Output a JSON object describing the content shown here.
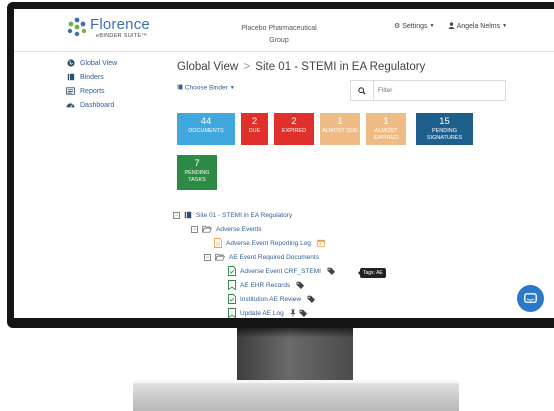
{
  "header": {
    "logo_word": "Florence",
    "logo_sub": "eBINDER SUITE™",
    "company_line1": "Placebo Pharmaceutical",
    "company_line2": "Group",
    "settings_label": "Settings",
    "user_name": "Angela Nelms"
  },
  "sidebar": {
    "items": [
      {
        "label": "Global View",
        "icon": "globe-icon"
      },
      {
        "label": "Binders",
        "icon": "binder-icon"
      },
      {
        "label": "Reports",
        "icon": "reports-icon"
      },
      {
        "label": "Dashboard",
        "icon": "dashboard-icon"
      }
    ]
  },
  "breadcrumb": {
    "root": "Global View",
    "separator": ">",
    "current": "Site 01 - STEMI in EA Regulatory"
  },
  "choose_binder_label": "Choose Binder",
  "search": {
    "placeholder": "Filter"
  },
  "tiles": [
    {
      "num": "44",
      "label": "DOCUMENTS",
      "color": "#40a8dc"
    },
    {
      "num": "2",
      "label": "DUE",
      "color": "#e0302c"
    },
    {
      "num": "2",
      "label": "EXPIRED",
      "color": "#e0302c"
    },
    {
      "num": "1",
      "label": "ALMOST DUE",
      "color": "#f0bc86"
    },
    {
      "num": "1",
      "label": "ALMOST EXPIRED",
      "color": "#f0bc86"
    },
    {
      "num": "15",
      "label": "PENDING SIGNATURES",
      "color": "#1f5f8c"
    },
    {
      "num": "7",
      "label": "PENDING TASKS",
      "color": "#2c8a44"
    }
  ],
  "tree": {
    "binder": "Site 01 - STEMI in EA Regulatory",
    "folder1": "Adverse Events",
    "doc1": "Adverse Event Reporting Log",
    "folder2": "AE Event Required Documents",
    "doc2": "Adverse Event CRF_STEMI",
    "doc3": "AE EHR Records",
    "doc4": "Institution AE Review",
    "doc5": "Update AE Log",
    "tooltip": "Tags: AE"
  }
}
